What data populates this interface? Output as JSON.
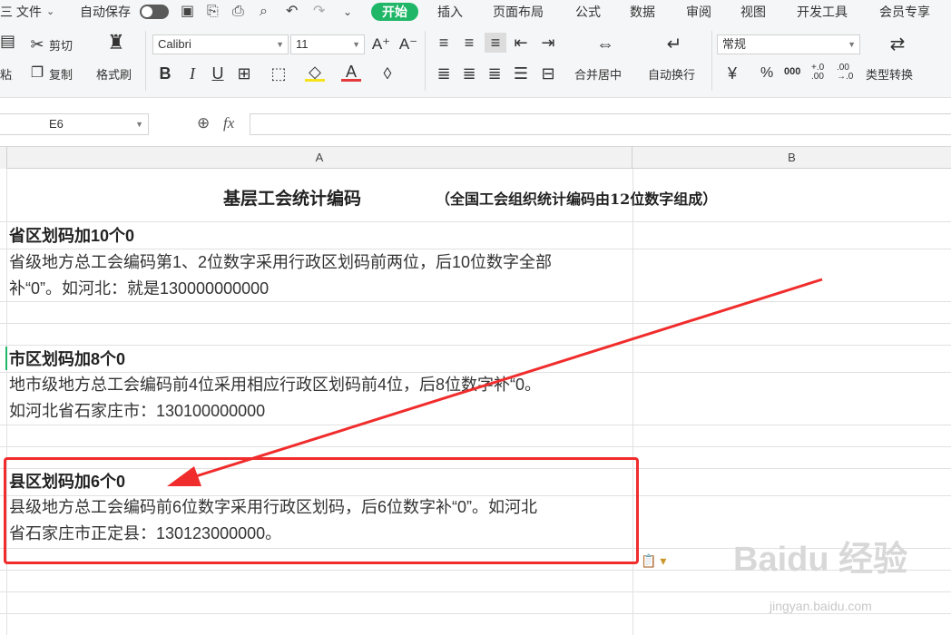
{
  "menubar": {
    "file": "三 文件",
    "autosave": "自动保存",
    "tabs": [
      "开始",
      "插入",
      "页面布局",
      "公式",
      "数据",
      "审阅",
      "视图",
      "开发工具",
      "会员专享"
    ]
  },
  "ribbon": {
    "paste": "粘贴",
    "cut": "剪切",
    "copy": "复制",
    "format_painter": "格式刷",
    "font_name": "Calibri",
    "font_size": "11",
    "merge_center": "合并居中",
    "wrap_text": "自动换行",
    "number_format": "常规",
    "type_convert": "类型转换",
    "percent": "%",
    "thousands": "000",
    "dec_increase": "+.0 .00",
    "dec_decrease": ".00 →.0"
  },
  "formula_bar": {
    "name_box": "E6",
    "fx": "fx",
    "value": ""
  },
  "sheet": {
    "columns": [
      "A",
      "B"
    ],
    "title": "基层工会统计编码",
    "subtitle": "（全国工会组织统计编码由12位数字组成）",
    "sections": [
      {
        "heading": "省区划码加10个0",
        "line1": "省级地方总工会编码第1、2位数字采用行政区划码前两位，后10位数字全部",
        "line2": "补“0”。如河北：就是130000000000"
      },
      {
        "heading": "市区划码加8个0",
        "line1": "地市级地方总工会编码前4位采用相应行政区划码前4位，后8位数字补“0。",
        "line2": "如河北省石家庄市：130100000000"
      },
      {
        "heading": "县区划码加6个0",
        "line1": "县级地方总工会编码前6位数字采用行政区划码，后6位数字补“0”。如河北",
        "line2": "省石家庄市正定县：130123000000。"
      }
    ]
  },
  "annotation": {
    "box_color": "#f02c2c",
    "arrow_color": "#f02c2c"
  },
  "watermark": {
    "logo": "Baidu 经验",
    "url": "jingyan.baidu.com"
  },
  "accent": "#1fb767"
}
